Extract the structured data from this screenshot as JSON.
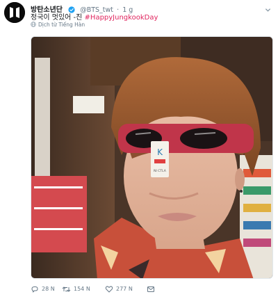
{
  "tweet": {
    "author_name": "방탄소년단",
    "handle": "@BTS_twt",
    "separator": "·",
    "time": "1 g",
    "text_plain": "정국이 멋있어 -진 ",
    "text_hashtag": "#HappyJungkookDay",
    "translate_label": "Dịch từ Tiếng Hàn",
    "photo_tag_text": "K",
    "photo_tag_small": "NI CTLA"
  },
  "actions": {
    "replies": "28 N",
    "retweets": "154 N",
    "likes": "277 N"
  },
  "colors": {
    "hashtag": "#e0245e",
    "verified": "#1da1f2",
    "muted": "#657786"
  },
  "icons": [
    "bts-logo-icon",
    "verified-badge-icon",
    "chevron-down-icon",
    "globe-icon",
    "reply-icon",
    "retweet-icon",
    "like-icon",
    "direct-message-icon"
  ]
}
